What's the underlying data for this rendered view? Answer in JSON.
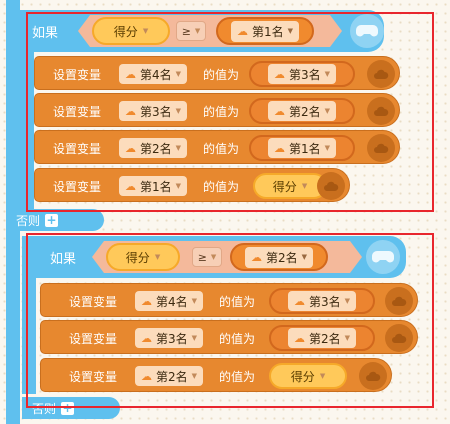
{
  "keywords": {
    "if": "如果",
    "else": "否则",
    "set_var": "设置变量",
    "value_is": "的值为",
    "plus": "+"
  },
  "block1": {
    "condition": {
      "left": "得分",
      "op": "≥",
      "right": "第1名"
    },
    "rows": [
      {
        "var": "第4名",
        "value": "第3名",
        "value_type": "cloud"
      },
      {
        "var": "第3名",
        "value": "第2名",
        "value_type": "cloud"
      },
      {
        "var": "第2名",
        "value": "第1名",
        "value_type": "cloud"
      },
      {
        "var": "第1名",
        "value": "得分",
        "value_type": "var"
      }
    ]
  },
  "block2": {
    "condition": {
      "left": "得分",
      "op": "≥",
      "right": "第2名"
    },
    "rows": [
      {
        "var": "第4名",
        "value": "第3名",
        "value_type": "cloud"
      },
      {
        "var": "第3名",
        "value": "第2名",
        "value_type": "cloud"
      },
      {
        "var": "第2名",
        "value": "得分",
        "value_type": "var"
      }
    ]
  },
  "colors": {
    "control": "#5fc0ee",
    "variable_block": "#e7882f",
    "highlight_box": "#e8262d"
  },
  "icons": {
    "cloud": "cloud-icon",
    "dropdown": "caret-down-icon",
    "gamepad": "gamepad-icon"
  }
}
